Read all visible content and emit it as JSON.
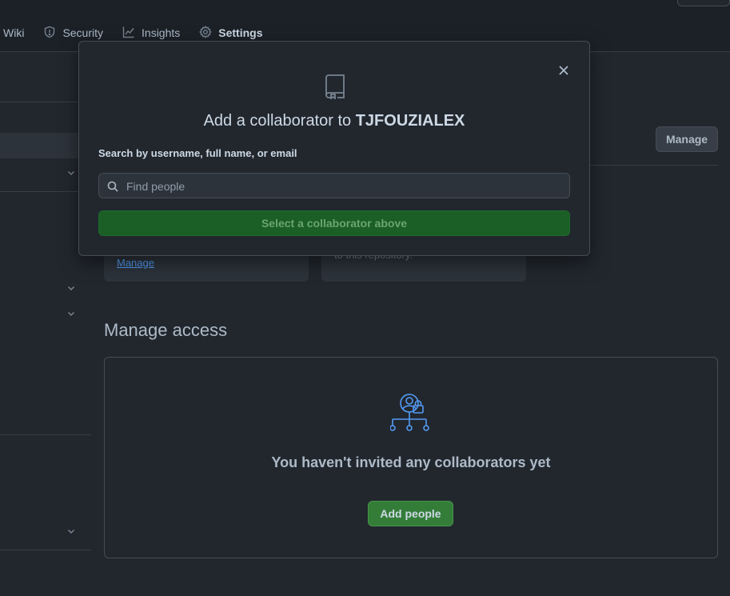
{
  "nav": {
    "tabs": [
      {
        "label": "Wiki",
        "icon": "book-icon"
      },
      {
        "label": "Security",
        "icon": "shield-icon"
      },
      {
        "label": "Insights",
        "icon": "graph-icon"
      },
      {
        "label": "Settings",
        "icon": "gear-icon",
        "active": true
      }
    ]
  },
  "header": {
    "manage_label": "Manage"
  },
  "cards": {
    "manage_link": "Manage",
    "repo_text": "to this repository."
  },
  "access": {
    "heading": "Manage access",
    "empty_text": "You haven't invited any collaborators yet",
    "add_people_label": "Add people"
  },
  "modal": {
    "title_prefix": "Add a collaborator to ",
    "repo_name": "TJFOUZIALEX",
    "search_label": "Search by username, full name, or email",
    "search_placeholder": "Find people",
    "search_value": "",
    "submit_label": "Select a collaborator above"
  },
  "colors": {
    "background": "#22272e",
    "primary_green": "#347d39",
    "disabled_green": "#1b5e26",
    "link_blue": "#539bf5"
  }
}
